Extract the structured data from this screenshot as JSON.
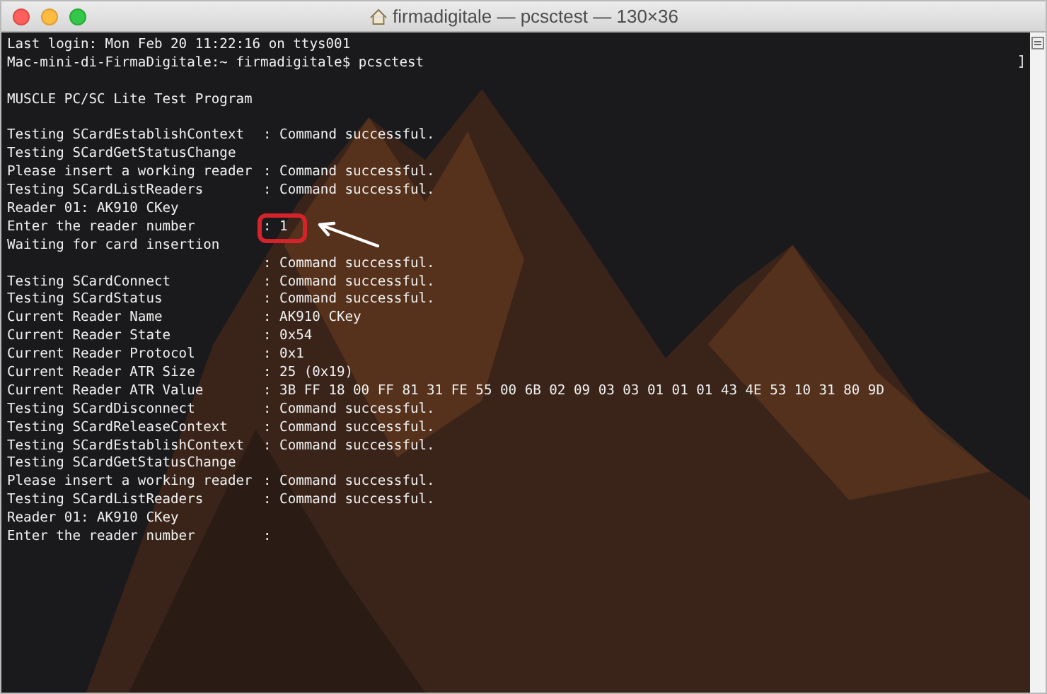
{
  "window": {
    "title": "firmadigitale — pcsctest — 130×36"
  },
  "terminal": {
    "lines": [
      {
        "kind": "text",
        "text": "Last login: Mon Feb 20 11:22:16 on ttys001"
      },
      {
        "kind": "text",
        "text": "Mac-mini-di-FirmaDigitale:~ firmadigitale$ pcsctest"
      },
      {
        "kind": "blank"
      },
      {
        "kind": "text",
        "text": "MUSCLE PC/SC Lite Test Program"
      },
      {
        "kind": "blank"
      },
      {
        "kind": "pair",
        "text": "Testing SCardEstablishContext",
        "value": ": Command successful.",
        "callout": false
      },
      {
        "kind": "text",
        "text": "Testing SCardGetStatusChange"
      },
      {
        "kind": "pair",
        "text": "Please insert a working reader",
        "value": ": Command successful.",
        "callout": false
      },
      {
        "kind": "pair",
        "text": "Testing SCardListReaders",
        "value": ": Command successful.",
        "callout": false
      },
      {
        "kind": "text",
        "text": "Reader 01: AK910 CKey"
      },
      {
        "kind": "pair",
        "text": "Enter the reader number",
        "value": ": 1",
        "callout": true
      },
      {
        "kind": "text",
        "text": "Waiting for card insertion"
      },
      {
        "kind": "value",
        "value": ": Command successful."
      },
      {
        "kind": "pair",
        "text": "Testing SCardConnect",
        "value": ": Command successful.",
        "callout": false
      },
      {
        "kind": "pair",
        "text": "Testing SCardStatus",
        "value": ": Command successful.",
        "callout": false
      },
      {
        "kind": "pair",
        "text": "Current Reader Name",
        "value": ": AK910 CKey",
        "callout": false
      },
      {
        "kind": "pair",
        "text": "Current Reader State",
        "value": ": 0x54",
        "callout": false
      },
      {
        "kind": "pair",
        "text": "Current Reader Protocol",
        "value": ": 0x1",
        "callout": false
      },
      {
        "kind": "pair",
        "text": "Current Reader ATR Size",
        "value": ": 25 (0x19)",
        "callout": false
      },
      {
        "kind": "pair",
        "text": "Current Reader ATR Value",
        "value": ": 3B FF 18 00 FF 81 31 FE 55 00 6B 02 09 03 03 01 01 01 43 4E 53 10 31 80 9D",
        "callout": false
      },
      {
        "kind": "pair",
        "text": "Testing SCardDisconnect",
        "value": ": Command successful.",
        "callout": false
      },
      {
        "kind": "pair",
        "text": "Testing SCardReleaseContext",
        "value": ": Command successful.",
        "callout": false
      },
      {
        "kind": "pair",
        "text": "Testing SCardEstablishContext",
        "value": ": Command successful.",
        "callout": false
      },
      {
        "kind": "text",
        "text": "Testing SCardGetStatusChange"
      },
      {
        "kind": "pair",
        "text": "Please insert a working reader",
        "value": ": Command successful.",
        "callout": false
      },
      {
        "kind": "pair",
        "text": "Testing SCardListReaders",
        "value": ": Command successful.",
        "callout": false
      },
      {
        "kind": "text",
        "text": "Reader 01: AK910 CKey"
      },
      {
        "kind": "pair",
        "text": "Enter the reader number",
        "value": ":",
        "callout": false
      }
    ]
  }
}
